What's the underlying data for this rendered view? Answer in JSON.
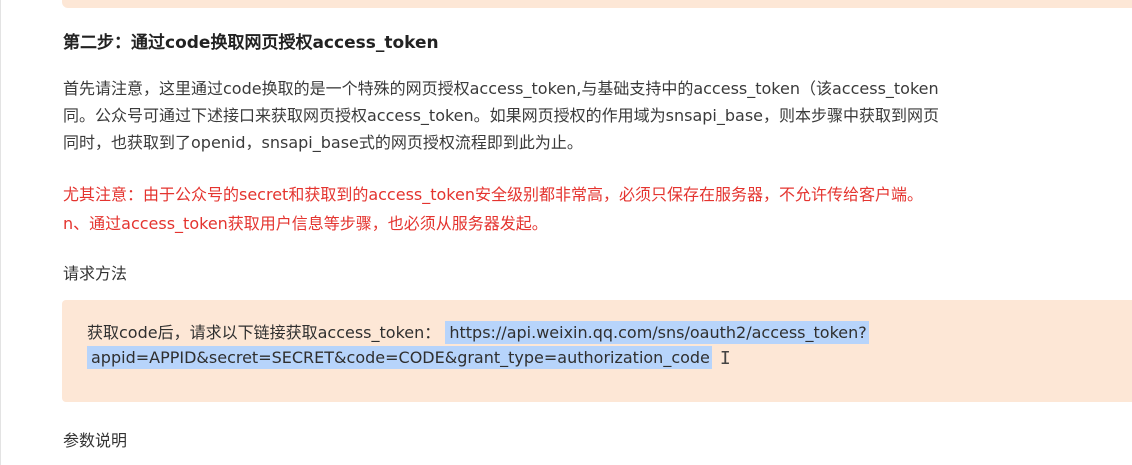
{
  "step": {
    "title": "第二步：通过code换取网页授权access_token"
  },
  "intro": {
    "lines": [
      "首先请注意，这里通过code换取的是一个特殊的网页授权access_token,与基础支持中的access_token（该access_token",
      "同。公众号可通过下述接口来获取网页授权access_token。如果网页授权的作用域为snsapi_base，则本步骤中获取到网页",
      "同时，也获取到了openid，snsapi_base式的网页授权流程即到此为止。"
    ]
  },
  "warning": {
    "lines": [
      "尤其注意：由于公众号的secret和获取到的access_token安全级别都非常高，必须只保存在服务器，不允许传给客户端。",
      "n、通过access_token获取用户信息等步骤，也必须从服务器发起。"
    ]
  },
  "request": {
    "label": "请求方法",
    "prefix": "获取code后，请求以下链接获取access_token：",
    "url_line1": "https://api.weixin.qq.com/sns/oauth2/access_token?",
    "url_line2": "appid=APPID&secret=SECRET&code=CODE&grant_type=authorization_code"
  },
  "params": {
    "label": "参数说明"
  },
  "colors": {
    "box_background": "#fde7d6",
    "selection": "#b7d4fb",
    "warning_text": "#e4342f"
  },
  "icons": {
    "cursor": "text-cursor-icon"
  }
}
